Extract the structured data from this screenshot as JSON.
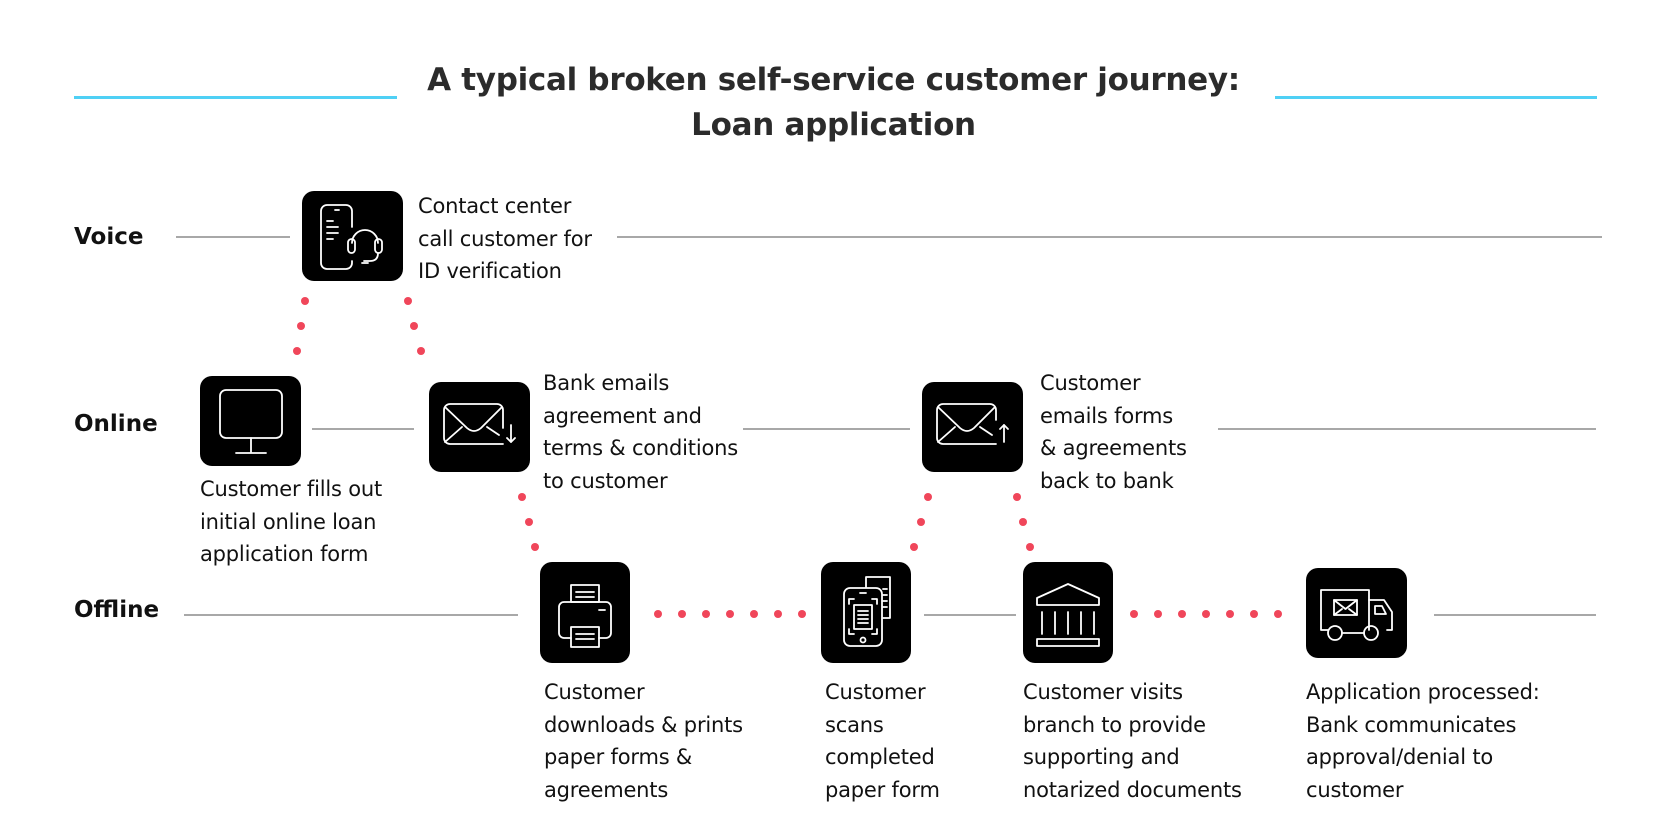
{
  "title": {
    "line1": "A typical broken self-service customer journey:",
    "line2": "Loan application"
  },
  "colors": {
    "accent_line": "#4fd0f5",
    "connector_dots": "#f0465a",
    "icon_tile": "#000000",
    "lane_line": "#a8a8a8"
  },
  "lanes": [
    {
      "id": "voice",
      "label": "Voice"
    },
    {
      "id": "online",
      "label": "Online"
    },
    {
      "id": "offline",
      "label": "Offline"
    }
  ],
  "steps": [
    {
      "id": "fill-form",
      "lane": "online",
      "icon": "desktop-monitor-icon",
      "text": "Customer fills out\ninitial online loan\napplication form"
    },
    {
      "id": "id-verification",
      "lane": "voice",
      "icon": "phone-headset-icon",
      "text": "Contact center\ncall customer for\nID verification"
    },
    {
      "id": "bank-emails",
      "lane": "online",
      "icon": "email-download-icon",
      "text": "Bank emails\nagreement and\nterms & conditions\nto customer"
    },
    {
      "id": "print-forms",
      "lane": "offline",
      "icon": "printer-icon",
      "text": "Customer\ndownloads & prints\npaper forms &\nagreements"
    },
    {
      "id": "scan-form",
      "lane": "offline",
      "icon": "mobile-scan-icon",
      "text": "Customer\nscans\ncompleted\npaper form"
    },
    {
      "id": "customer-emails",
      "lane": "online",
      "icon": "email-upload-icon",
      "text": "Customer\nemails forms\n& agreements\nback to bank"
    },
    {
      "id": "branch-visit",
      "lane": "offline",
      "icon": "bank-building-icon",
      "text": "Customer visits\nbranch to provide\nsupporting and\nnotarized documents"
    },
    {
      "id": "processed",
      "lane": "offline",
      "icon": "delivery-truck-icon",
      "text": "Application processed:\nBank communicates\napproval/denial to\ncustomer"
    }
  ],
  "connections": [
    {
      "from": "fill-form",
      "to": "id-verification",
      "style": "dotted"
    },
    {
      "from": "id-verification",
      "to": "bank-emails",
      "style": "dotted"
    },
    {
      "from": "bank-emails",
      "to": "print-forms",
      "style": "dotted"
    },
    {
      "from": "print-forms",
      "to": "scan-form",
      "style": "dotted"
    },
    {
      "from": "scan-form",
      "to": "customer-emails",
      "style": "dotted"
    },
    {
      "from": "customer-emails",
      "to": "branch-visit",
      "style": "dotted"
    },
    {
      "from": "branch-visit",
      "to": "processed",
      "style": "dotted"
    }
  ]
}
